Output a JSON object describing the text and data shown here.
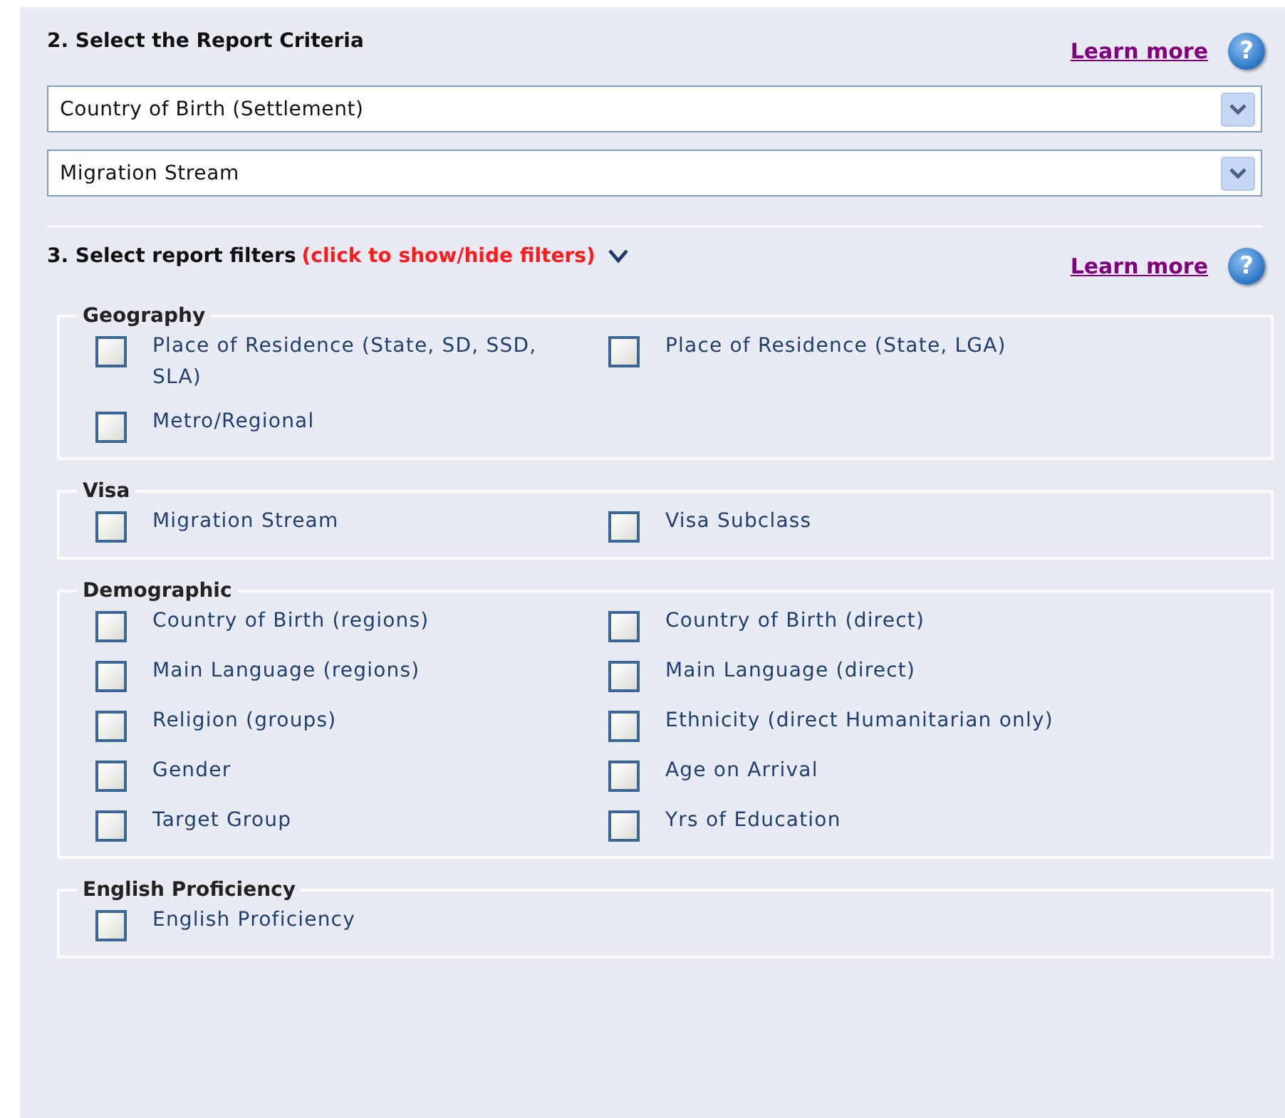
{
  "criteria": {
    "title": "2. Select the Report Criteria",
    "learn_more": "Learn more",
    "help": "?",
    "dropdowns": [
      {
        "value": "Country of Birth (Settlement)"
      },
      {
        "value": "Migration Stream"
      }
    ]
  },
  "filters": {
    "title": "3. Select report filters",
    "toggle": "(click to show/hide filters)",
    "expanded": true,
    "learn_more": "Learn more",
    "help": "?",
    "groups": [
      {
        "legend": "Geography",
        "options": [
          {
            "label": "Place of Residence (State, SD, SSD, SLA)",
            "checked": false
          },
          {
            "label": "Place of Residence (State, LGA)",
            "checked": false
          },
          {
            "label": "Metro/Regional",
            "checked": false
          }
        ]
      },
      {
        "legend": "Visa",
        "options": [
          {
            "label": "Migration Stream",
            "checked": false
          },
          {
            "label": "Visa Subclass",
            "checked": false
          }
        ]
      },
      {
        "legend": "Demographic",
        "options": [
          {
            "label": "Country of Birth (regions)",
            "checked": false
          },
          {
            "label": "Country of Birth (direct)",
            "checked": false
          },
          {
            "label": "Main Language (regions)",
            "checked": false
          },
          {
            "label": "Main Language (direct)",
            "checked": false
          },
          {
            "label": "Religion (groups)",
            "checked": false
          },
          {
            "label": "Ethnicity (direct Humanitarian only)",
            "checked": false
          },
          {
            "label": "Gender",
            "checked": false
          },
          {
            "label": "Age on Arrival",
            "checked": false
          },
          {
            "label": "Target Group",
            "checked": false
          },
          {
            "label": "Yrs of Education",
            "checked": false
          }
        ]
      },
      {
        "legend": "English Proficiency",
        "options": [
          {
            "label": "English Proficiency",
            "checked": false
          }
        ]
      }
    ]
  }
}
